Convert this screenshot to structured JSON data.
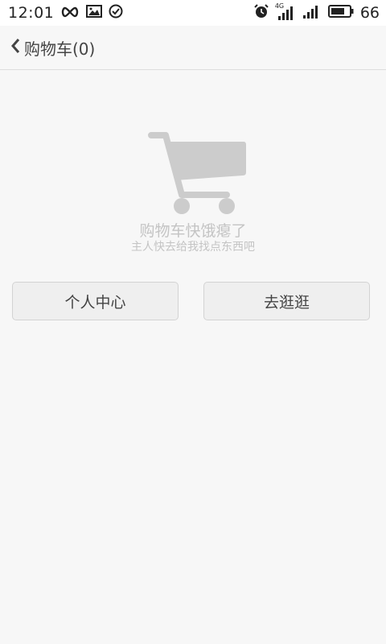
{
  "status_bar": {
    "time": "12:01",
    "left_icons": [
      "infinity-icon",
      "image-icon",
      "check-circle-icon"
    ],
    "right_icons": [
      "alarm-icon",
      "signal-4g-icon",
      "signal-icon",
      "battery-icon"
    ],
    "network_label": "4G",
    "battery_percent": "66"
  },
  "nav": {
    "title": "购物车(0)"
  },
  "empty_state": {
    "icon": "cart-icon",
    "title": "购物车快饿瘪了",
    "subtitle": "主人快去给我找点东西吧"
  },
  "buttons": {
    "left_label": "个人中心",
    "right_label": "去逛逛"
  },
  "colors": {
    "background": "#f7f7f7",
    "status_bar": "#ffffff",
    "muted_text": "#c4c4c4",
    "cart_icon": "#cccccc",
    "button_bg": "#efefef",
    "button_border": "#d3d3d3"
  }
}
